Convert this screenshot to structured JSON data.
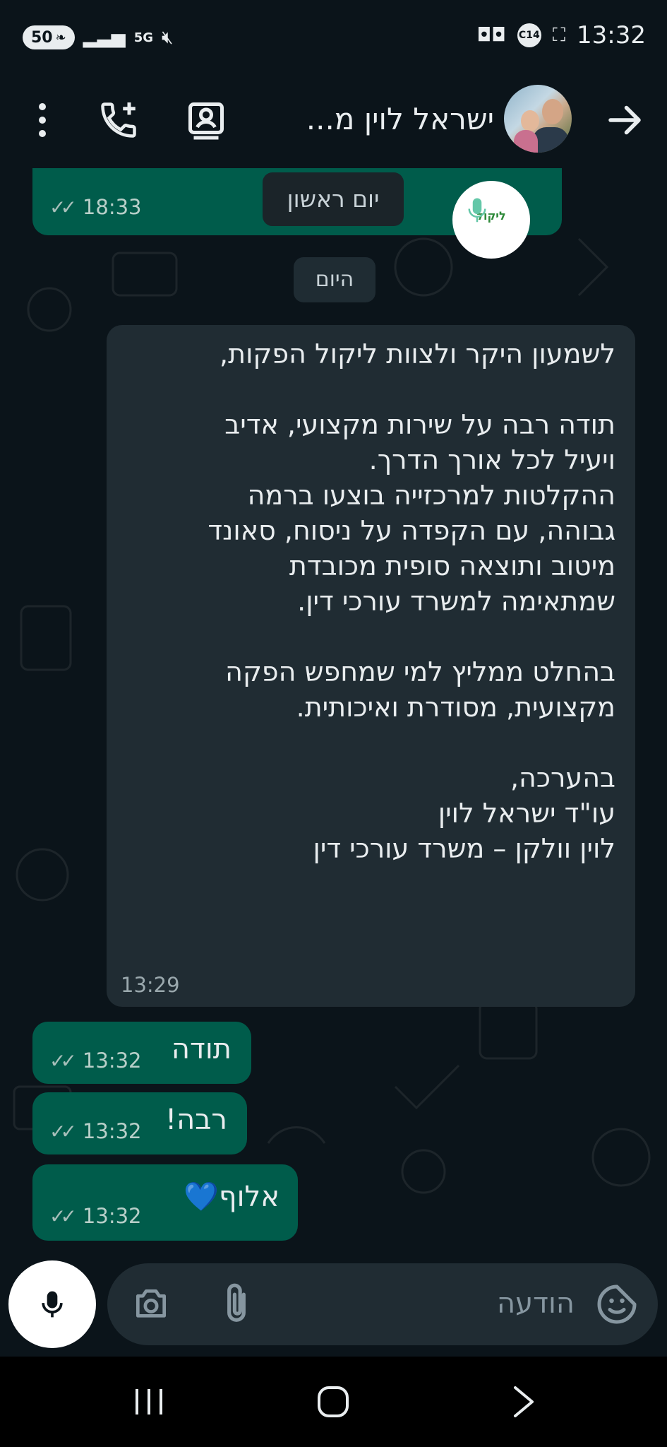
{
  "status_bar": {
    "time": "13:32",
    "battery_label": "50",
    "network": "5G",
    "notification_badge": "C14"
  },
  "header": {
    "contact_name": "ישראל לוין מ...",
    "icons": [
      "more-vert-icon",
      "add-call-icon",
      "contact-card-icon",
      "arrow-forward-icon"
    ]
  },
  "chat": {
    "voice_message": {
      "time": "18:33",
      "logo_text": "ליקול"
    },
    "date_pills": {
      "sunday": "יום ראשון",
      "today": "היום"
    },
    "incoming": {
      "text": "לשמעון היקר ולצוות ליקול הפקות,\n\nתודה רבה על שירות מקצועי, אדיב\nויעיל לכל אורך הדרך.\nההקלטות למרכזייה בוצעו ברמה\nגבוהה, עם הקפדה על ניסוח, סאונד\nמיטוב ותוצאה סופית מכובדת\nשמתאימה למשרד עורכי דין.\n\nבהחלט ממליץ למי שמחפש הפקה\nמקצועית, מסודרת ואיכותית.\n\nבהערכה,\nעו\"ד ישראל לוין\nלוין וולקן – משרד עורכי דין",
      "time": "13:29"
    },
    "outgoing": [
      {
        "text": "תודה",
        "time": "13:32"
      },
      {
        "text": "רבה!",
        "time": "13:32"
      },
      {
        "text": "אלוף",
        "emoji": "💙",
        "time": "13:32"
      }
    ]
  },
  "composer": {
    "placeholder": "הודעה",
    "icons": [
      "mic-icon",
      "camera-icon",
      "attach-icon",
      "sticker-icon"
    ]
  },
  "navigation": {
    "icons": [
      "recents-icon",
      "home-icon",
      "back-icon"
    ]
  },
  "colors": {
    "background": "#0b141a",
    "outgoing_bubble": "#005c4b",
    "incoming_bubble": "#202c33",
    "text": "#e9edef",
    "tick": "#a8bfba"
  }
}
